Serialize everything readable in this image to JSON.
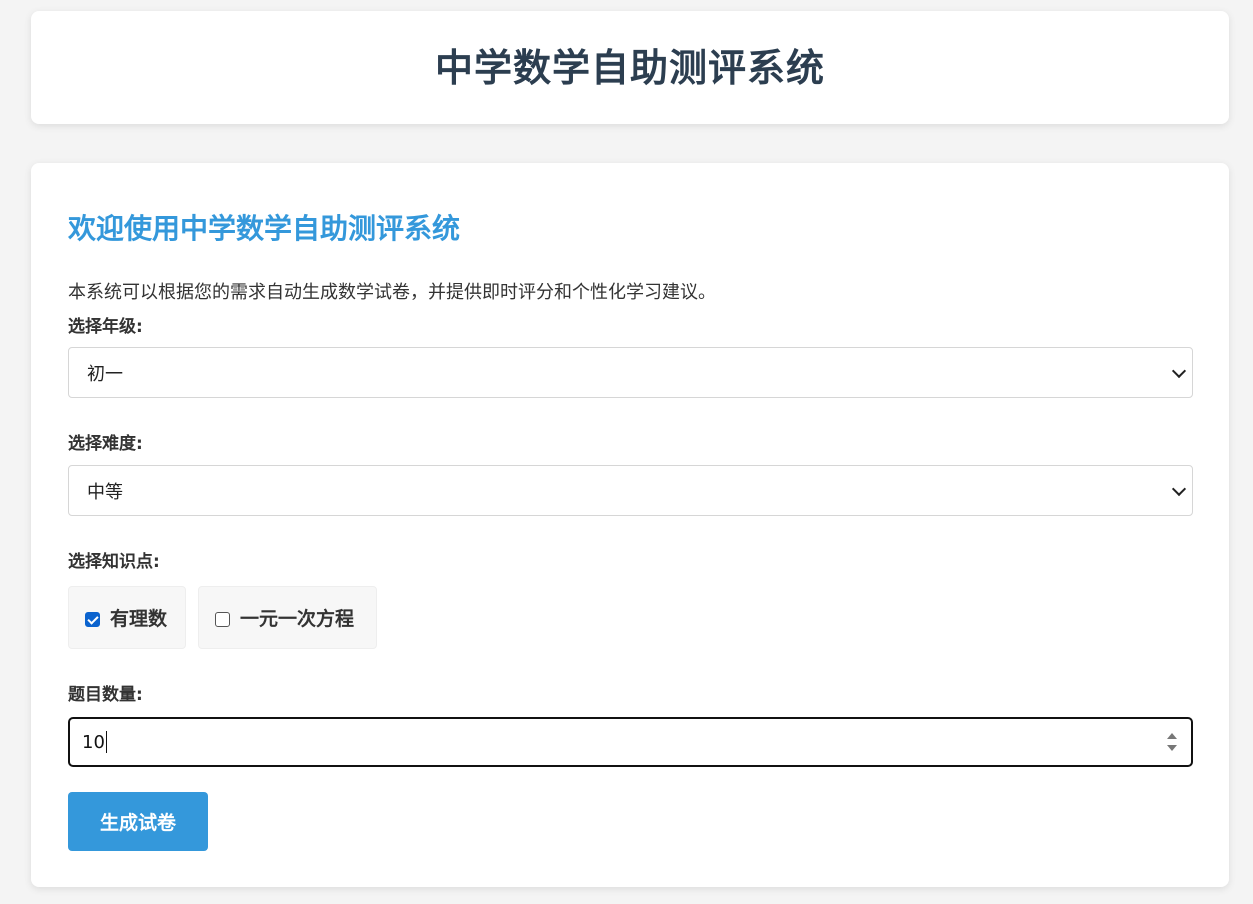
{
  "header": {
    "title": "中学数学自助测评系统"
  },
  "main": {
    "welcome_title": "欢迎使用中学数学自助测评系统",
    "intro": "本系统可以根据您的需求自动生成数学试卷，并提供即时评分和个性化学习建议。",
    "grade": {
      "label": "选择年级:",
      "selected": "初一"
    },
    "difficulty": {
      "label": "选择难度:",
      "selected": "中等"
    },
    "topics": {
      "label": "选择知识点:",
      "items": [
        {
          "label": "有理数",
          "checked": true
        },
        {
          "label": "一元一次方程",
          "checked": false
        }
      ]
    },
    "question_count": {
      "label": "题目数量:",
      "value": "10"
    },
    "generate_button": "生成试卷"
  },
  "colors": {
    "accent": "#3498db",
    "title": "#2c3e50",
    "checkbox_checked": "#0b63ce"
  },
  "icons": {
    "select_arrow": "chevron-down-icon",
    "number_spinner": "spinner-icon"
  }
}
